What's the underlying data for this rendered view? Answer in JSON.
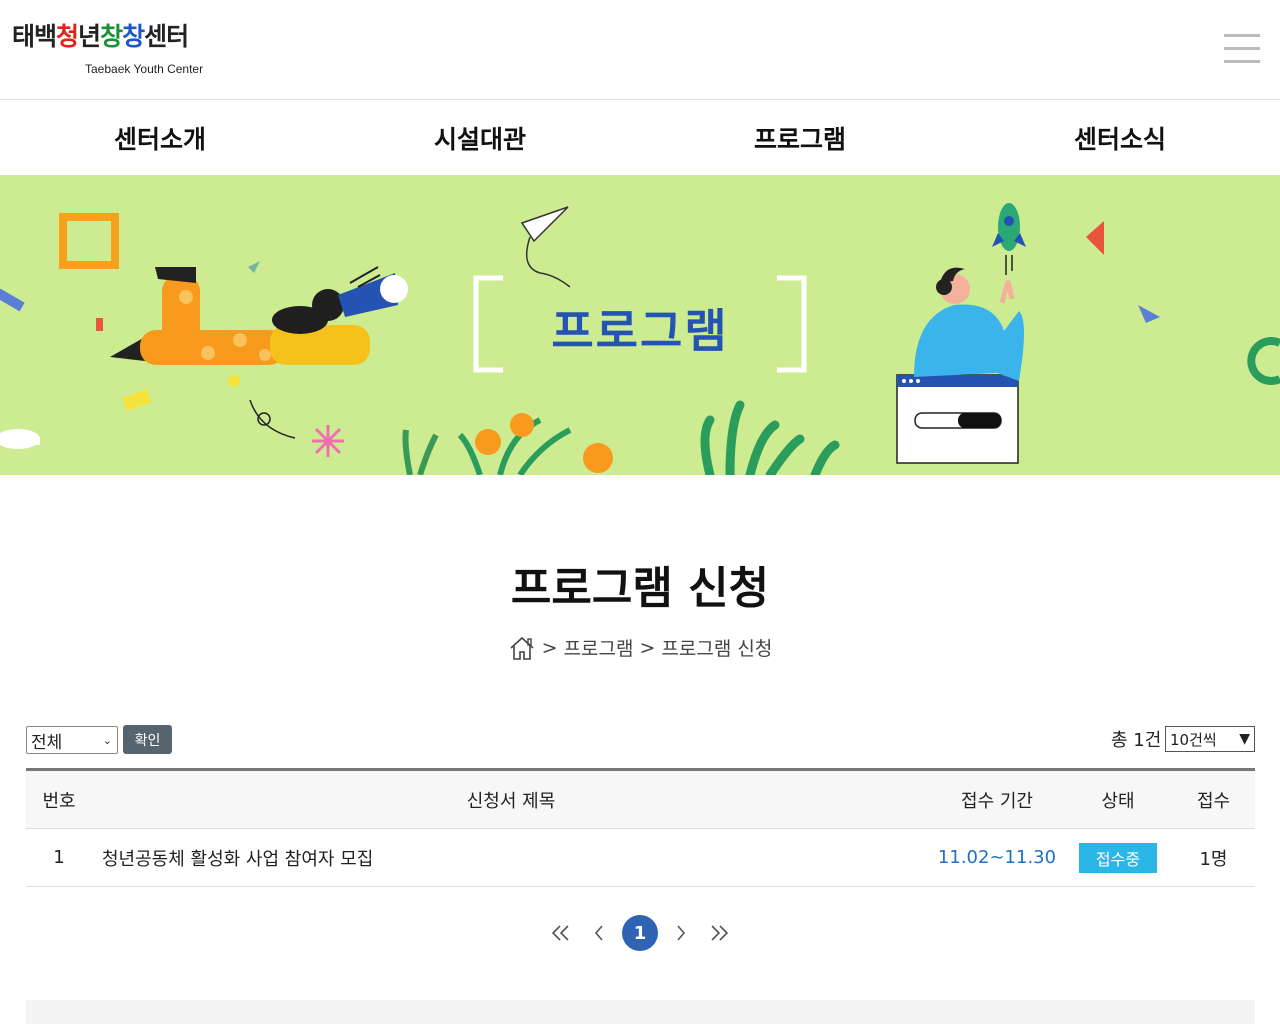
{
  "header": {
    "logo_text": "태백청년창창센터",
    "logo_subtitle": "Taebaek Youth Center",
    "menu_icon": "hamburger-menu-icon"
  },
  "nav": {
    "items": [
      {
        "label": "센터소개"
      },
      {
        "label": "시설대관"
      },
      {
        "label": "프로그램"
      },
      {
        "label": "센터소식"
      }
    ]
  },
  "banner": {
    "title": "프로그램",
    "background_color": "#cdec92",
    "title_color": "#2453b3"
  },
  "page": {
    "title": "프로그램 신청",
    "breadcrumb": {
      "home_icon": "home-icon",
      "items": [
        "프로그램",
        "프로그램 신청"
      ],
      "separator": ">"
    }
  },
  "filter": {
    "category_value": "전체",
    "confirm_label": "확인",
    "total_label": "총 1건",
    "per_page_value": "10건씩"
  },
  "table": {
    "columns": [
      "번호",
      "신청서 제목",
      "접수 기간",
      "상태",
      "접수"
    ],
    "rows": [
      {
        "no": "1",
        "title": "청년공동체 활성화 사업 참여자 모집",
        "period": "11.02~11.30",
        "status": "접수중",
        "count": "1명"
      }
    ],
    "status_color": "#2ab7e8",
    "period_color": "#1f6fc5"
  },
  "pagination": {
    "current_page": "1",
    "icons": [
      "double-chevron-left-icon",
      "chevron-left-icon",
      "chevron-right-icon",
      "double-chevron-right-icon"
    ],
    "active_color": "#2f64b4"
  }
}
